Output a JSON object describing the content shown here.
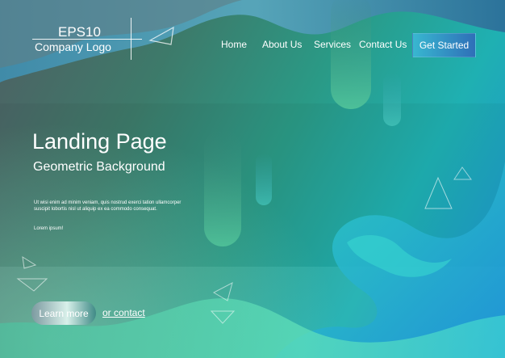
{
  "logo": {
    "line1": "EPS10",
    "line2": "Company Logo"
  },
  "nav": {
    "items": [
      "Home",
      "About Us",
      "Services",
      "Contact Us"
    ],
    "cta": "Get Started"
  },
  "hero": {
    "title": "Landing Page",
    "subtitle": "Geometric Background",
    "body": "Ut wisi enim ad minim veniam, quis nostrud exerci tation ullamcorper suscipit lobortis nisl ut aliquip ex ea commodo consequat.",
    "body2": "Lorem ipsum!",
    "primary_button": "Learn more",
    "secondary_link": "or contact"
  },
  "colors": {
    "accent_blue": "#2f6fb8",
    "teal": "#1fb0b2",
    "green": "#2a9a86"
  },
  "icons": [
    "triangle-outline-icon"
  ]
}
